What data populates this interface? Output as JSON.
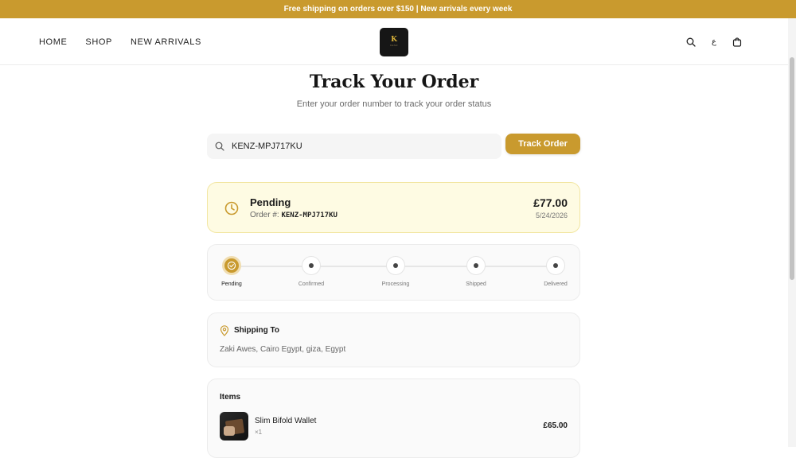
{
  "announcement": "Free shipping on orders over $150 | New arrivals every week",
  "nav": {
    "home": "HOME",
    "shop": "SHOP",
    "new_arrivals": "NEW ARRIVALS"
  },
  "header": {
    "language_label": "ع",
    "icons": [
      "search-icon",
      "language-icon",
      "cart-icon"
    ]
  },
  "page": {
    "title": "Track Your Order",
    "subtitle": "Enter your order number to track your order status"
  },
  "search": {
    "value": "KENZ-MPJ717KU",
    "button": "Track Order"
  },
  "order": {
    "status": "Pending",
    "number_label": "Order #:",
    "number": "KENZ-MPJ717KU",
    "total": "£77.00",
    "date": "5/24/2026"
  },
  "steps": [
    "Pending",
    "Confirmed",
    "Processing",
    "Shipped",
    "Delivered"
  ],
  "active_step": 0,
  "shipping": {
    "title": "Shipping To",
    "address": "Zaki Awes, Cairo Egypt, giza, Egypt"
  },
  "items": {
    "title": "Items",
    "list": [
      {
        "name": "Slim Bifold Wallet",
        "qty": "×1",
        "price": "£65.00"
      }
    ]
  },
  "colors": {
    "accent": "#c99a2e",
    "status_bg": "#fefbe3",
    "card_bg": "#fafafa"
  }
}
